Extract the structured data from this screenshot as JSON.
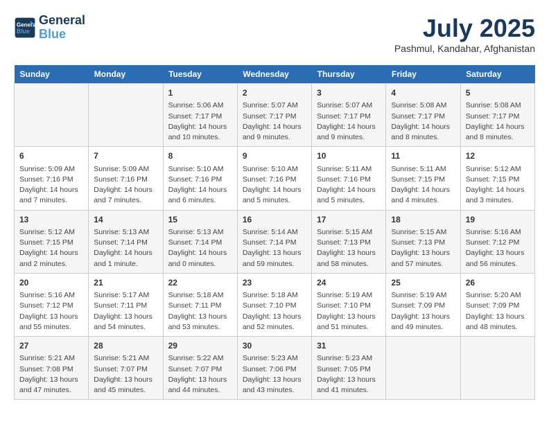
{
  "header": {
    "logo_line1": "General",
    "logo_line2": "Blue",
    "title": "July 2025",
    "subtitle": "Pashmul, Kandahar, Afghanistan"
  },
  "calendar": {
    "days_of_week": [
      "Sunday",
      "Monday",
      "Tuesday",
      "Wednesday",
      "Thursday",
      "Friday",
      "Saturday"
    ],
    "weeks": [
      [
        {
          "day": "",
          "info": ""
        },
        {
          "day": "",
          "info": ""
        },
        {
          "day": "1",
          "info": "Sunrise: 5:06 AM\nSunset: 7:17 PM\nDaylight: 14 hours and 10 minutes."
        },
        {
          "day": "2",
          "info": "Sunrise: 5:07 AM\nSunset: 7:17 PM\nDaylight: 14 hours and 9 minutes."
        },
        {
          "day": "3",
          "info": "Sunrise: 5:07 AM\nSunset: 7:17 PM\nDaylight: 14 hours and 9 minutes."
        },
        {
          "day": "4",
          "info": "Sunrise: 5:08 AM\nSunset: 7:17 PM\nDaylight: 14 hours and 8 minutes."
        },
        {
          "day": "5",
          "info": "Sunrise: 5:08 AM\nSunset: 7:17 PM\nDaylight: 14 hours and 8 minutes."
        }
      ],
      [
        {
          "day": "6",
          "info": "Sunrise: 5:09 AM\nSunset: 7:16 PM\nDaylight: 14 hours and 7 minutes."
        },
        {
          "day": "7",
          "info": "Sunrise: 5:09 AM\nSunset: 7:16 PM\nDaylight: 14 hours and 7 minutes."
        },
        {
          "day": "8",
          "info": "Sunrise: 5:10 AM\nSunset: 7:16 PM\nDaylight: 14 hours and 6 minutes."
        },
        {
          "day": "9",
          "info": "Sunrise: 5:10 AM\nSunset: 7:16 PM\nDaylight: 14 hours and 5 minutes."
        },
        {
          "day": "10",
          "info": "Sunrise: 5:11 AM\nSunset: 7:16 PM\nDaylight: 14 hours and 5 minutes."
        },
        {
          "day": "11",
          "info": "Sunrise: 5:11 AM\nSunset: 7:15 PM\nDaylight: 14 hours and 4 minutes."
        },
        {
          "day": "12",
          "info": "Sunrise: 5:12 AM\nSunset: 7:15 PM\nDaylight: 14 hours and 3 minutes."
        }
      ],
      [
        {
          "day": "13",
          "info": "Sunrise: 5:12 AM\nSunset: 7:15 PM\nDaylight: 14 hours and 2 minutes."
        },
        {
          "day": "14",
          "info": "Sunrise: 5:13 AM\nSunset: 7:14 PM\nDaylight: 14 hours and 1 minute."
        },
        {
          "day": "15",
          "info": "Sunrise: 5:13 AM\nSunset: 7:14 PM\nDaylight: 14 hours and 0 minutes."
        },
        {
          "day": "16",
          "info": "Sunrise: 5:14 AM\nSunset: 7:14 PM\nDaylight: 13 hours and 59 minutes."
        },
        {
          "day": "17",
          "info": "Sunrise: 5:15 AM\nSunset: 7:13 PM\nDaylight: 13 hours and 58 minutes."
        },
        {
          "day": "18",
          "info": "Sunrise: 5:15 AM\nSunset: 7:13 PM\nDaylight: 13 hours and 57 minutes."
        },
        {
          "day": "19",
          "info": "Sunrise: 5:16 AM\nSunset: 7:12 PM\nDaylight: 13 hours and 56 minutes."
        }
      ],
      [
        {
          "day": "20",
          "info": "Sunrise: 5:16 AM\nSunset: 7:12 PM\nDaylight: 13 hours and 55 minutes."
        },
        {
          "day": "21",
          "info": "Sunrise: 5:17 AM\nSunset: 7:11 PM\nDaylight: 13 hours and 54 minutes."
        },
        {
          "day": "22",
          "info": "Sunrise: 5:18 AM\nSunset: 7:11 PM\nDaylight: 13 hours and 53 minutes."
        },
        {
          "day": "23",
          "info": "Sunrise: 5:18 AM\nSunset: 7:10 PM\nDaylight: 13 hours and 52 minutes."
        },
        {
          "day": "24",
          "info": "Sunrise: 5:19 AM\nSunset: 7:10 PM\nDaylight: 13 hours and 51 minutes."
        },
        {
          "day": "25",
          "info": "Sunrise: 5:19 AM\nSunset: 7:09 PM\nDaylight: 13 hours and 49 minutes."
        },
        {
          "day": "26",
          "info": "Sunrise: 5:20 AM\nSunset: 7:09 PM\nDaylight: 13 hours and 48 minutes."
        }
      ],
      [
        {
          "day": "27",
          "info": "Sunrise: 5:21 AM\nSunset: 7:08 PM\nDaylight: 13 hours and 47 minutes."
        },
        {
          "day": "28",
          "info": "Sunrise: 5:21 AM\nSunset: 7:07 PM\nDaylight: 13 hours and 45 minutes."
        },
        {
          "day": "29",
          "info": "Sunrise: 5:22 AM\nSunset: 7:07 PM\nDaylight: 13 hours and 44 minutes."
        },
        {
          "day": "30",
          "info": "Sunrise: 5:23 AM\nSunset: 7:06 PM\nDaylight: 13 hours and 43 minutes."
        },
        {
          "day": "31",
          "info": "Sunrise: 5:23 AM\nSunset: 7:05 PM\nDaylight: 13 hours and 41 minutes."
        },
        {
          "day": "",
          "info": ""
        },
        {
          "day": "",
          "info": ""
        }
      ]
    ]
  }
}
